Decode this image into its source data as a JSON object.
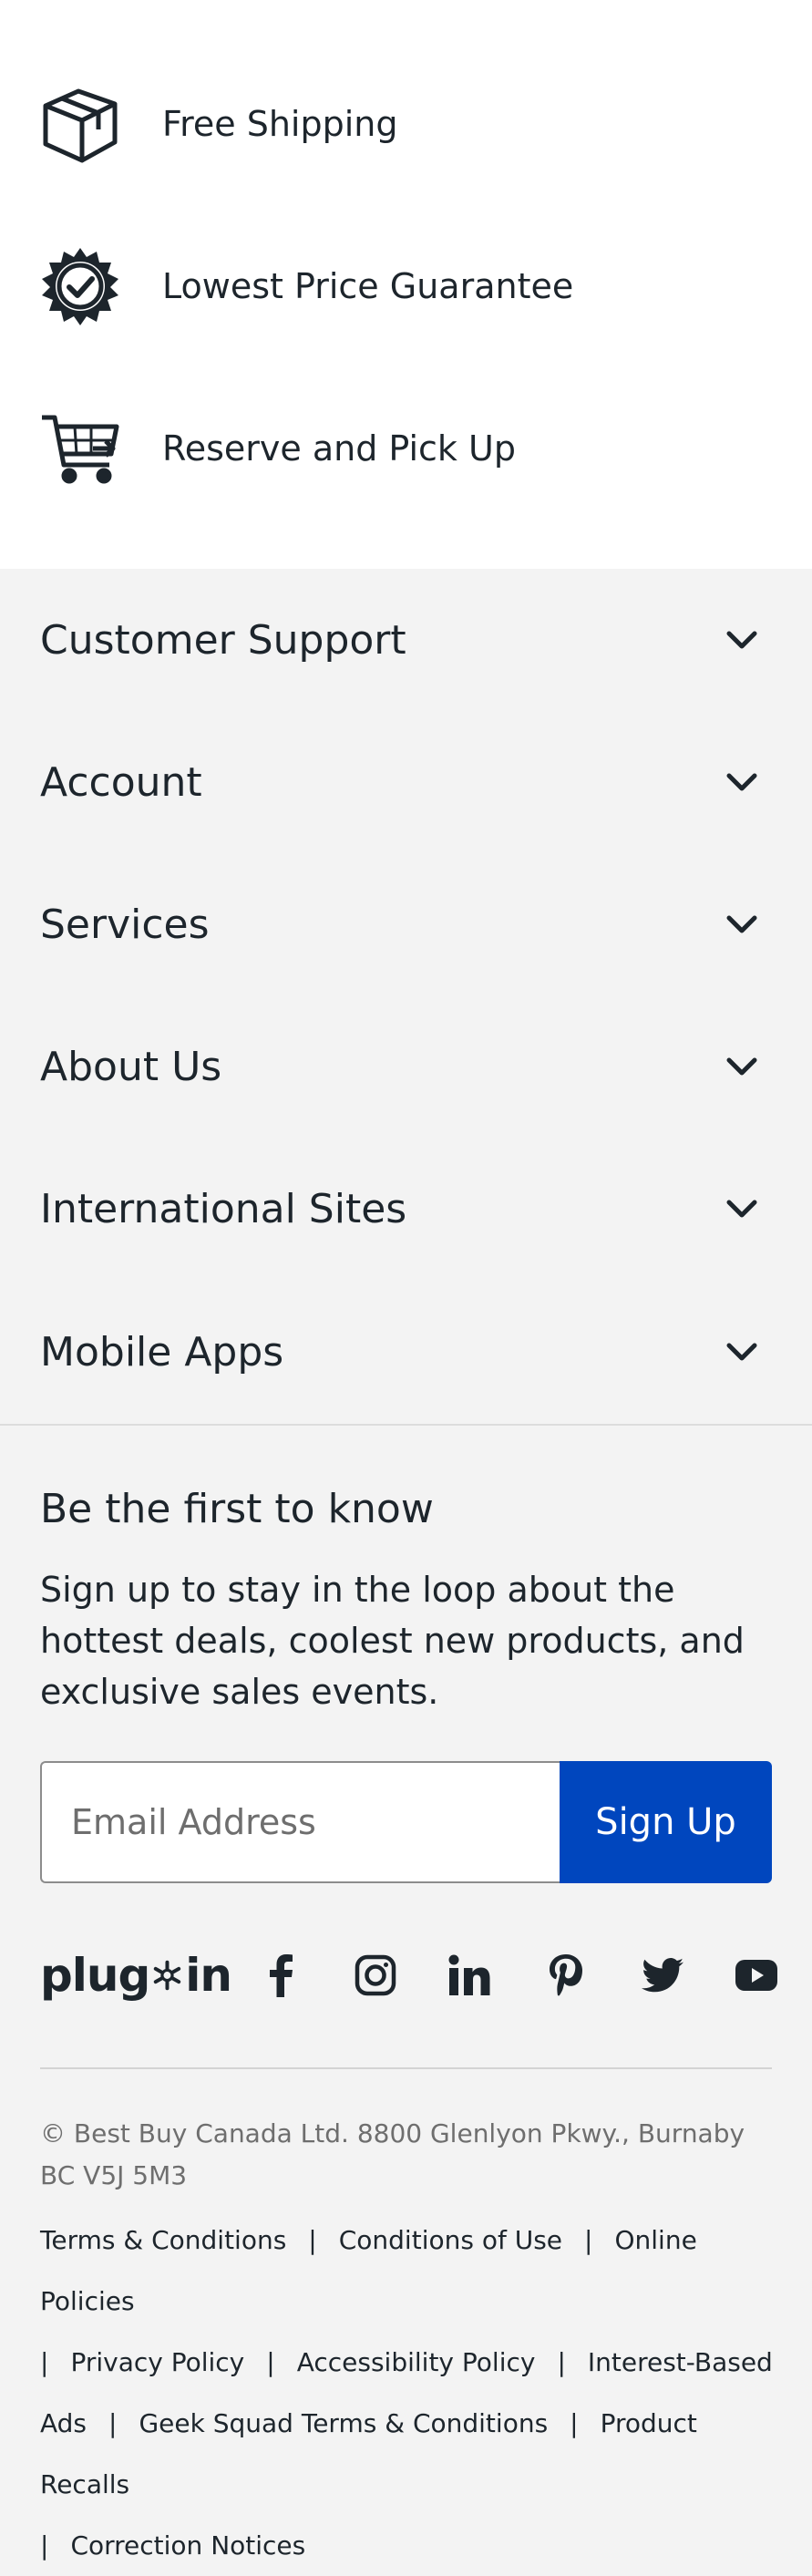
{
  "benefits": [
    {
      "label": "Free Shipping",
      "icon": "box-icon"
    },
    {
      "label": "Lowest Price Guarantee",
      "icon": "badge-check-icon"
    },
    {
      "label": "Reserve and Pick Up",
      "icon": "cart-icon"
    }
  ],
  "accordion": [
    "Customer Support",
    "Account",
    "Services",
    "About Us",
    "International Sites",
    "Mobile Apps"
  ],
  "newsletter": {
    "title": "Be the first to know",
    "body": "Sign up to stay in the loop about the hottest deals, coolest new products, and exclusive sales events.",
    "email_placeholder": "Email Address",
    "signup_label": "Sign Up"
  },
  "social": {
    "brand": "plug",
    "brand_suffix": "in",
    "icons": [
      "facebook-icon",
      "instagram-icon",
      "linkedin-icon",
      "pinterest-icon",
      "twitter-icon",
      "youtube-icon"
    ]
  },
  "footer": {
    "copyright": "© Best Buy Canada Ltd. 8800 Glenlyon Pkwy., Burnaby BC V5J 5M3",
    "separator": "|",
    "links": [
      "Terms & Conditions",
      "Conditions of Use",
      "Online Policies",
      "Privacy Policy",
      "Accessibility Policy",
      "Interest-Based Ads",
      "Geek Squad Terms & Conditions",
      "Product Recalls",
      "Correction Notices"
    ]
  },
  "colors": {
    "brand_blue": "#0046be",
    "text": "#1d252c",
    "muted": "#6e6e6e",
    "panel_bg": "#f3f3f3"
  }
}
